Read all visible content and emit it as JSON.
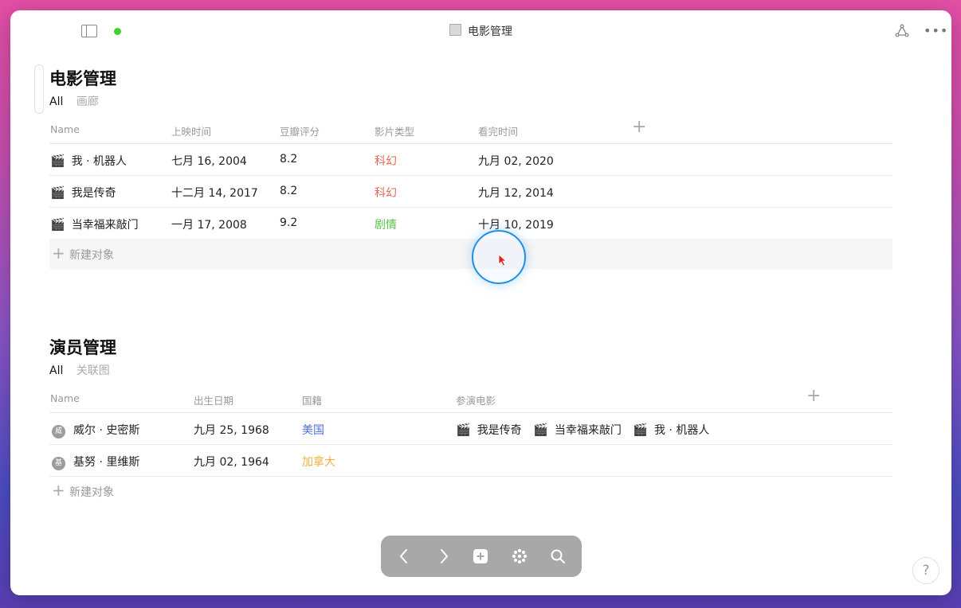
{
  "window": {
    "title": "电影管理",
    "status_color": "#3fd22c"
  },
  "movies": {
    "title": "电影管理",
    "views": {
      "active": "All",
      "other": "画廊"
    },
    "columns": [
      "Name",
      "上映时间",
      "豆瓣评分",
      "影片类型",
      "看完时间"
    ],
    "rows": [
      {
        "name": "我 · 机器人",
        "release": "七月 16, 2004",
        "rating": "8.2",
        "genre": "科幻",
        "genre_color": "red",
        "watched": "九月 02, 2020"
      },
      {
        "name": "我是传奇",
        "release": "十二月 14, 2017",
        "rating": "8.2",
        "genre": "科幻",
        "genre_color": "red",
        "watched": "九月 12, 2014"
      },
      {
        "name": "当幸福来敲门",
        "release": "一月 17, 2008",
        "rating": "9.2",
        "genre": "剧情",
        "genre_color": "green",
        "watched": "十月 10, 2019"
      }
    ],
    "new_label": "新建对象"
  },
  "actors": {
    "title": "演员管理",
    "views": {
      "active": "All",
      "other": "关联图"
    },
    "columns": [
      "Name",
      "出生日期",
      "国籍",
      "参演电影"
    ],
    "rows": [
      {
        "avatar": "威",
        "name": "威尔 · 史密斯",
        "birth": "九月 25, 1968",
        "country": "美国",
        "country_color": "blue",
        "movies": [
          "我是传奇",
          "当幸福来敲门",
          "我 · 机器人"
        ]
      },
      {
        "avatar": "基",
        "name": "基努 · 里维斯",
        "birth": "九月 02, 1964",
        "country": "加拿大",
        "country_color": "orange",
        "movies": []
      }
    ],
    "new_label": "新建对象"
  },
  "icons": {
    "sidebar": "sidebar-toggle-icon",
    "share": "share-icon",
    "more": "more-icon",
    "movie": "clapperboard-icon",
    "toolbar": [
      "back-icon",
      "forward-icon",
      "add-icon",
      "apps-icon",
      "search-icon"
    ]
  },
  "help_label": "?"
}
